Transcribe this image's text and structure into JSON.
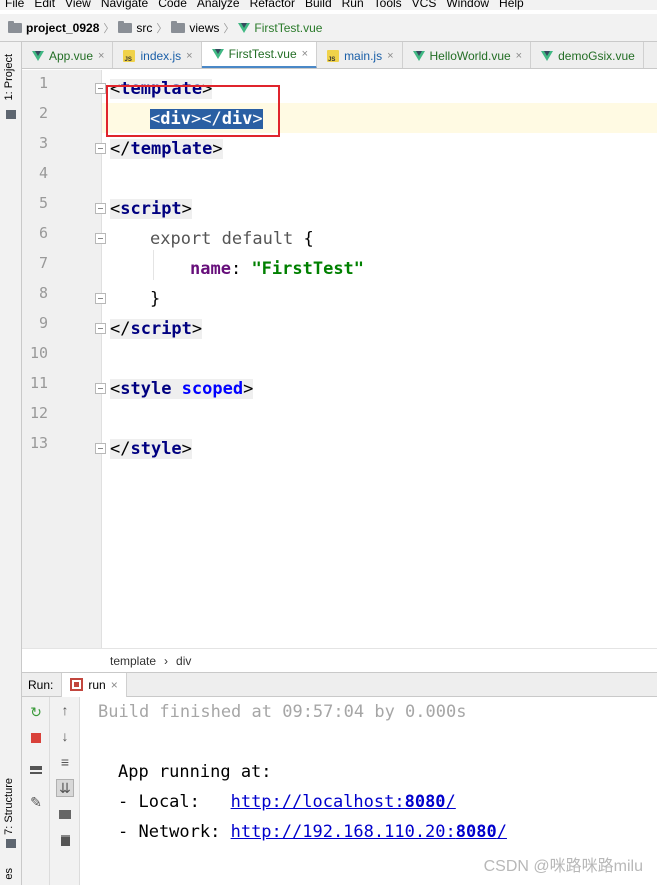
{
  "menu": {
    "items": [
      "File",
      "Edit",
      "View",
      "Navigate",
      "Code",
      "Analyze",
      "Refactor",
      "Build",
      "Run",
      "Tools",
      "VCS",
      "Window",
      "Help"
    ]
  },
  "nav": {
    "project": "project_0928",
    "folder1": "src",
    "folder2": "views",
    "file": "FirstTest.vue"
  },
  "left_strip": {
    "project_tab": "1: Project",
    "structure_tab": "7: Structure",
    "bottom_tab": "es"
  },
  "tabs": [
    {
      "label": "App.vue",
      "type": "vue",
      "active": false
    },
    {
      "label": "index.js",
      "type": "js",
      "active": false
    },
    {
      "label": "FirstTest.vue",
      "type": "vue",
      "active": true
    },
    {
      "label": "main.js",
      "type": "js",
      "active": false
    },
    {
      "label": "HelloWorld.vue",
      "type": "vue",
      "active": false
    },
    {
      "label": "demoGsix.vue",
      "type": "vue",
      "active": false
    }
  ],
  "tab_close": "×",
  "editor": {
    "line_numbers": [
      "1",
      "2",
      "3",
      "4",
      "5",
      "6",
      "7",
      "8",
      "9",
      "10",
      "11",
      "12",
      "13"
    ],
    "code": {
      "l1_open": "<",
      "l1_tag": "template",
      "l1_close": ">",
      "l2_open": "<",
      "l2_tag": "div",
      "l2_mid": "></",
      "l2_tag2": "div",
      "l2_close": ">",
      "l3_open": "</",
      "l3_tag": "template",
      "l3_close": ">",
      "l5_open": "<",
      "l5_tag": "script",
      "l5_close": ">",
      "l6_kw": "export default",
      "l6_brace": " {",
      "l7_prop": "name",
      "l7_colon": ": ",
      "l7_str": "\"FirstTest\"",
      "l8_brace": "}",
      "l9_open": "</",
      "l9_tag": "script",
      "l9_close": ">",
      "l11_open": "<",
      "l11_tag": "style",
      "l11_attr": " scoped",
      "l11_close": ">",
      "l13_open": "</",
      "l13_tag": "style",
      "l13_close": ">"
    }
  },
  "editor_breadcrumb": {
    "first": "template",
    "sep": "›",
    "second": "div"
  },
  "run": {
    "label": "Run:",
    "tab_label": "run",
    "tab_close": "×"
  },
  "console": {
    "build_line": "Build finished at 09:57:04 by 0.000s",
    "app_running": "App running at:",
    "local_label": "- Local:   ",
    "local_url_prefix": "http://localhost:",
    "local_port": "8080",
    "local_url_suffix": "/",
    "network_label": "- Network: ",
    "network_url_prefix": "http://192.168.110.20:",
    "network_port": "8080",
    "network_url_suffix": "/"
  },
  "watermark": "CSDN @咪路咪路milu"
}
